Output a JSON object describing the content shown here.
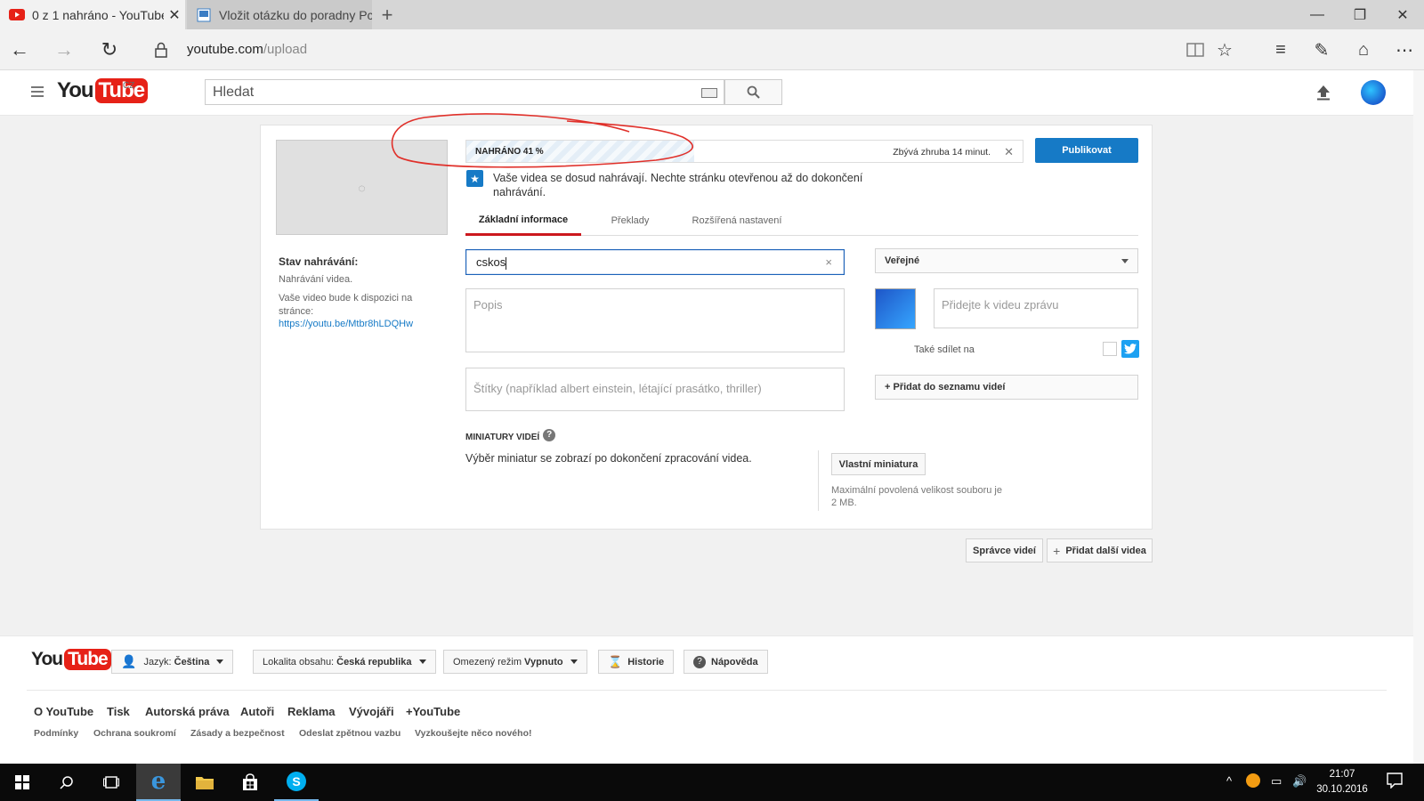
{
  "browser": {
    "tabs": [
      {
        "label": "0 z 1 nahráno - YouTube",
        "active": true
      },
      {
        "label": "Vložit otázku do poradny Pc",
        "active": false
      }
    ],
    "address": {
      "domain": "youtube.com",
      "path": "/upload"
    }
  },
  "youtube": {
    "logo_you": "You",
    "logo_tube": "Tube",
    "region": "CZ",
    "search_placeholder": "Hledat"
  },
  "upload": {
    "progress_label": "NAHRÁNO 41 %",
    "progress_value": 41,
    "remaining": "Zbývá zhruba 14 minut.",
    "publish_label": "Publikovat",
    "notice": "Vaše videa se dosud nahrávají. Nechte stránku otevřenou až do dokončení nahrávání.",
    "tabs": [
      "Základní informace",
      "Překlady",
      "Rozšířená nastavení"
    ],
    "title_value": "cskos",
    "description_placeholder": "Popis",
    "tags_placeholder": "Štítky (například albert einstein, létající prasátko, thriller)",
    "visibility": "Veřejné",
    "message_placeholder": "Přidejte k videu zprávu",
    "share_label": "Také sdílet na",
    "playlist_label": "+ Přidat do seznamu videí",
    "thumbs_title": "MINIATURY VIDEÍ",
    "thumbs_text": "Výběr miniatur se zobrazí po dokončení zpracování videa.",
    "custom_thumb_label": "Vlastní miniatura",
    "max_size": "Maximální povolená velikost souboru je 2 MB."
  },
  "status": {
    "title": "Stav nahrávání:",
    "text": "Nahrávání videa.",
    "available": "Vaše video bude k dispozici na stránce:",
    "link": "https://youtu.be/Mtbr8hLDQHw"
  },
  "actions": {
    "manager": "Správce videí",
    "add_more": "Přidat další videa"
  },
  "footer": {
    "language_label": "Jazyk:",
    "language_value": "Čeština",
    "location_label": "Lokalita obsahu:",
    "location_value": "Česká republika",
    "restricted_label": "Omezený režim",
    "restricted_value": "Vypnuto",
    "history": "Historie",
    "help": "Nápověda",
    "links_primary": [
      "O YouTube",
      "Tisk",
      "Autorská práva",
      "Autoři",
      "Reklama",
      "Vývojáři",
      "+YouTube"
    ],
    "links_secondary": [
      "Podmínky",
      "Ochrana soukromí",
      "Zásady a bezpečnost",
      "Odeslat zpětnou vazbu",
      "Vyzkoušejte něco nového!"
    ]
  },
  "taskbar": {
    "time": "21:07",
    "date": "30.10.2016"
  },
  "colors": {
    "accent": "#167ac6",
    "brand_red": "#e62117",
    "tab_active_underline": "#cc181e",
    "annotation": "#e0302a"
  }
}
